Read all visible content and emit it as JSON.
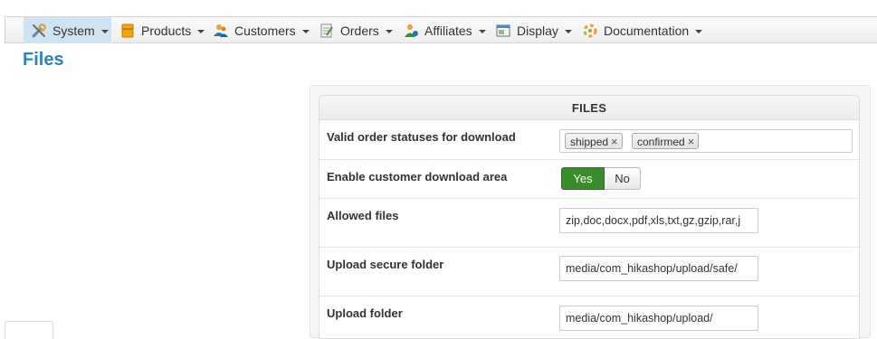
{
  "menu": {
    "items": [
      {
        "label": "System",
        "icon": "tools-icon"
      },
      {
        "label": "Products",
        "icon": "box-icon"
      },
      {
        "label": "Customers",
        "icon": "customers-icon"
      },
      {
        "label": "Orders",
        "icon": "orders-icon"
      },
      {
        "label": "Affiliates",
        "icon": "affiliates-icon"
      },
      {
        "label": "Display",
        "icon": "display-icon"
      },
      {
        "label": "Documentation",
        "icon": "documentation-icon"
      }
    ],
    "active_color": "#cfe3f3"
  },
  "page": {
    "title": "Files",
    "title_color": "#2a85ba"
  },
  "files_panel": {
    "header": "FILES",
    "rows": {
      "order_statuses": {
        "label": "Valid order statuses for download",
        "tags": [
          "shipped",
          "confirmed"
        ],
        "remove_glyph": "×"
      },
      "customer_download_area": {
        "label": "Enable customer download area",
        "yes_label": "Yes",
        "no_label": "No",
        "selected": "Yes",
        "yes_color": "#3c8a2e"
      },
      "allowed_files": {
        "label": "Allowed files",
        "value": "zip,doc,docx,pdf,xls,txt,gz,gzip,rar,j"
      },
      "upload_secure_folder": {
        "label": "Upload secure folder",
        "value": "media/com_hikashop/upload/safe/"
      },
      "upload_folder": {
        "label": "Upload folder",
        "value": "media/com_hikashop/upload/"
      }
    }
  }
}
